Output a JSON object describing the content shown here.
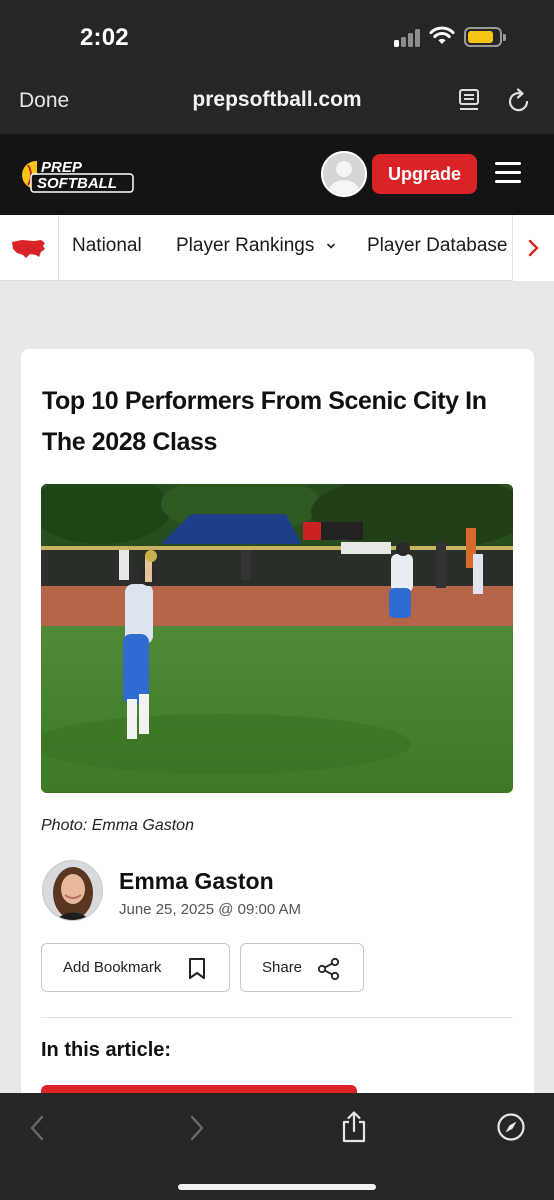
{
  "status_bar": {
    "time": "2:02"
  },
  "browser": {
    "done_label": "Done",
    "url": "prepsoftball.com"
  },
  "site": {
    "logo_line1": "PREP",
    "logo_line2": "SOFTBALL",
    "upgrade_label": "Upgrade"
  },
  "nav": {
    "items": [
      {
        "label": "National"
      },
      {
        "label": "Player Rankings"
      },
      {
        "label": "Player Database"
      }
    ]
  },
  "article": {
    "title": "Top 10 Performers From Scenic City In The 2028 Class",
    "photo_caption": "Photo: Emma Gaston",
    "author_name": "Emma Gaston",
    "date": "June 25, 2025 @ 09:00 AM",
    "bookmark_label": "Add Bookmark",
    "share_label": "Share",
    "toc_heading": "In this article:"
  },
  "colors": {
    "brand_red": "#d92326",
    "header_dark": "#141414",
    "browser_chrome": "#262626",
    "logo_yellow": "#f5c518"
  },
  "icons": {
    "browser_top": [
      "reader-mode-icon",
      "reload-icon"
    ],
    "toolbar": [
      "back-arrow-icon",
      "forward-arrow-icon",
      "share-icon",
      "compass-icon"
    ],
    "nav": [
      "us-map-icon",
      "chevron-down-icon",
      "chevron-right-icon"
    ],
    "article": [
      "bookmark-icon",
      "share-nodes-icon"
    ]
  }
}
